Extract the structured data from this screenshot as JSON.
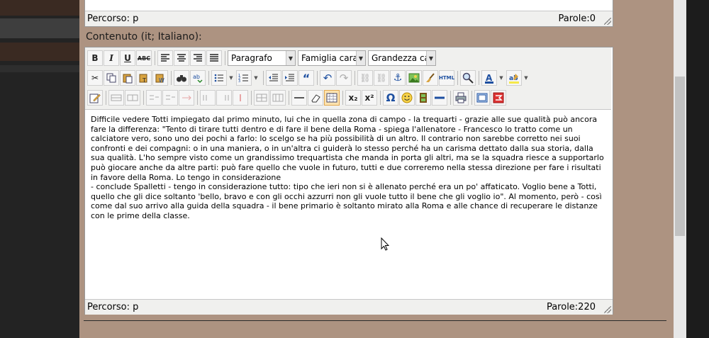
{
  "top_editor": {
    "path_label": "Percorso: p",
    "word_count": "Parole:0"
  },
  "field": {
    "label": "Contenuto (it; Italiano):"
  },
  "toolbar": {
    "bold": "B",
    "italic": "I",
    "underline": "U",
    "strikethrough": "ABC",
    "format_select": "Paragrafo",
    "font_family_select": "Famiglia caratt",
    "font_size_select": "Grandezza car",
    "html_label": "HTML",
    "subscript": "x₂",
    "superscript": "x²",
    "omega": "Ω"
  },
  "editor": {
    "paragraph1": "Difficile vedere Totti impiegato dal primo minuto, lui che in quella zona di campo - la trequarti - grazie alle sue qualità può ancora fare la differenza: \"Tento di tirare tutti dentro e di fare il bene della Roma - spiega l'allenatore - Francesco lo tratto come un calciatore vero, sono uno dei pochi a farlo: lo scelgo se ha più possibilità di un altro. Il contrario non sarebbe corretto nei suoi confronti e dei compagni: o in una maniera, o in un'altra ci guiderà lo stesso perché ha un carisma dettato dalla sua storia, dalla sua qualità. L'ho sempre visto come un grandissimo trequartista che manda in porta gli altri, ma se la squadra riesce a supportarlo può giocare anche da altre parti: può fare quello che vuole in futuro, tutti e due correremo nella stessa direzione per fare i risultati in favore della Roma. Lo tengo in considerazione",
    "paragraph2": "- conclude Spalletti - tengo in considerazione tutto: tipo che ieri non si è allenato perché era un po' affaticato. Voglio bene a Totti, quello che gli dice soltanto 'bello, bravo e con gli occhi azzurri non gli vuole tutto il bene che gli voglio io\". Al momento, però - così come dal suo arrivo alla guida della squadra - il bene primario è soltanto mirato alla Roma e alle chance di recuperare le distanze con le prime della classe.",
    "path_label": "Percorso: p",
    "word_count": "Parole:220"
  },
  "colors": {
    "panel": "#ad9381",
    "toolbar_bg": "#f0f0ee",
    "active_button": "#fce3b0"
  }
}
